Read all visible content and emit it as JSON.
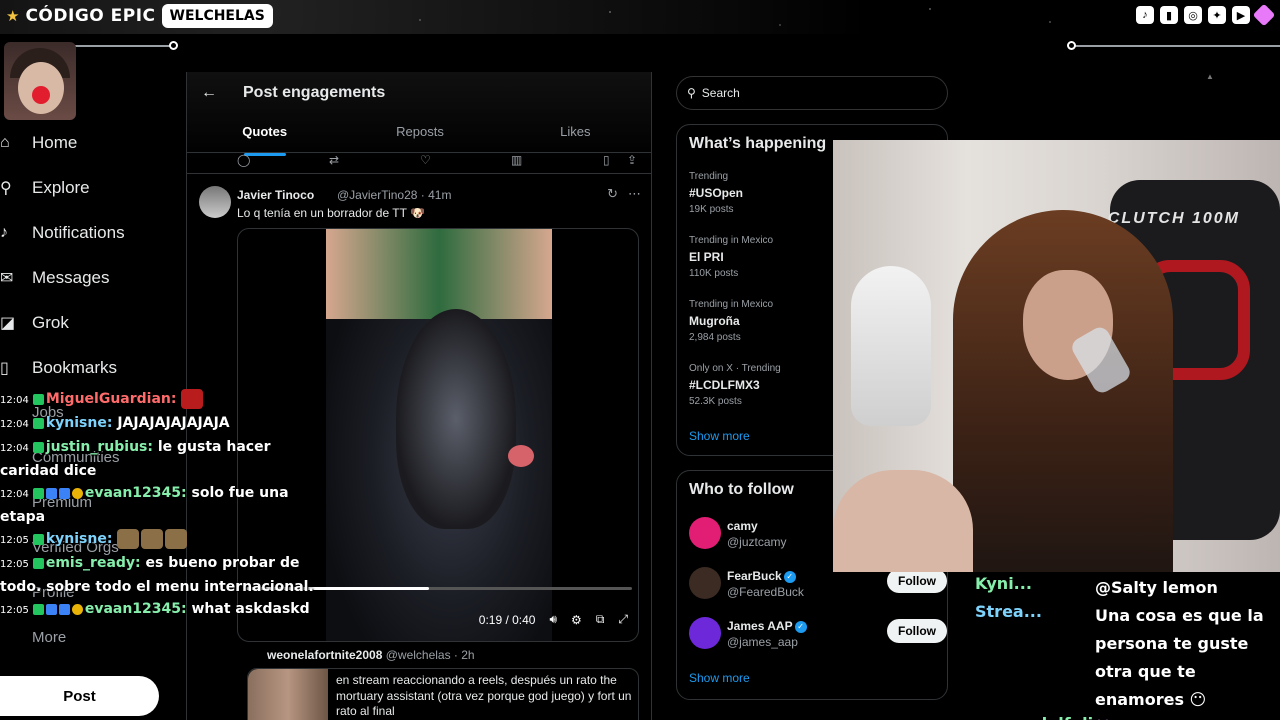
{
  "overlay": {
    "brand_code": "CÓDIGO EPIC",
    "brand_pill": "WELCHELAS"
  },
  "nav": {
    "items": [
      {
        "label": "Home",
        "icon": "home-icon"
      },
      {
        "label": "Explore",
        "icon": "search-icon"
      },
      {
        "label": "Notifications",
        "icon": "bell-icon"
      },
      {
        "label": "Messages",
        "icon": "mail-icon"
      },
      {
        "label": "Grok",
        "icon": "grok-icon"
      },
      {
        "label": "Bookmarks",
        "icon": "bookmark-icon"
      },
      {
        "label": "Jobs",
        "icon": "briefcase-icon"
      },
      {
        "label": "Communities",
        "icon": "people-icon"
      },
      {
        "label": "Premium",
        "icon": "x-icon"
      },
      {
        "label": "Verified Orgs",
        "icon": "lightning-icon"
      },
      {
        "label": "Profile",
        "icon": "person-icon"
      },
      {
        "label": "More",
        "icon": "more-icon"
      }
    ],
    "post_label": "Post"
  },
  "center": {
    "title": "Post engagements",
    "tabs": [
      "Quotes",
      "Reposts",
      "Likes"
    ],
    "tweet": {
      "name": "Javier Tinoco",
      "handle": "@JavierTino28 · 41m",
      "text": "Lo q tenía en un borrador de TT 🐶",
      "video_time": "0:19 / 0:40",
      "video_progress": 0.475
    },
    "tweet2": {
      "name": "weonelafortnite2008",
      "handle": "@welchelas · 2h",
      "quote_text": "en stream reaccionando a reels, después un rato the mortuary assistant (otra vez porque god juego) y fort un rato al final"
    }
  },
  "right": {
    "search_placeholder": "Search",
    "whats_happening": {
      "title": "What’s happening",
      "trends": [
        {
          "context": "Trending",
          "topic": "#USOpen",
          "posts": "19K posts"
        },
        {
          "context": "Trending in Mexico",
          "topic": "El PRI",
          "posts": "110K posts"
        },
        {
          "context": "Trending in Mexico",
          "topic": "Mugroña",
          "posts": "2,984 posts"
        },
        {
          "context": "Only on X · Trending",
          "topic": "#LCDLFMX3",
          "posts": "52.3K posts"
        }
      ],
      "show_more": "Show more"
    },
    "who_to_follow": {
      "title": "Who to follow",
      "accounts": [
        {
          "name": "camy",
          "handle": "@juztcamy",
          "color": "#e11d74"
        },
        {
          "name": "FearBuck",
          "handle": "@FearedBuck",
          "color": "#3b2b22",
          "follow": "Follow"
        },
        {
          "name": "James AAP",
          "handle": "@james_aap",
          "color": "#6d28d9",
          "follow": "Follow"
        }
      ],
      "show_more": "Show more"
    }
  },
  "webcam": {
    "chair_text": "CLUTCH 100M"
  },
  "chat_left": [
    {
      "time": "12:04",
      "user": "MiguelGuardian:",
      "color": "#ff6b6b",
      "text": ""
    },
    {
      "time": "12:04",
      "user": "kynisne:",
      "color": "#7dd3fc",
      "text": "JAJAJAJAJAJAJA"
    },
    {
      "time": "12:04",
      "user": "justin_rubius:",
      "color": "#86efac",
      "text": "le gusta hacer caridad dice"
    },
    {
      "time": "12:04",
      "user": "evaan12345:",
      "color": "#86efac",
      "text": "solo fue una etapa"
    },
    {
      "time": "12:05",
      "user": "kynisne:",
      "color": "#7dd3fc",
      "text": ""
    },
    {
      "time": "12:05",
      "user": "emis_ready:",
      "color": "#86efac",
      "text": "es bueno probar de todo. sobre todo el menu internacional."
    },
    {
      "time": "12:05",
      "user": "evaan12345:",
      "color": "#86efac",
      "text": "what askdaskd"
    }
  ],
  "chat_right": [
    {
      "user": "Kyni...",
      "color": "#86efac",
      "text": "@Salty lemon"
    },
    {
      "user": "Strea...",
      "color": "#7dd3fc",
      "text": "Una cosa es que la persona te guste otra que te enamores 😶"
    },
    {
      "user": "adolfuli",
      "color": "#86efac",
      "text": ""
    }
  ]
}
